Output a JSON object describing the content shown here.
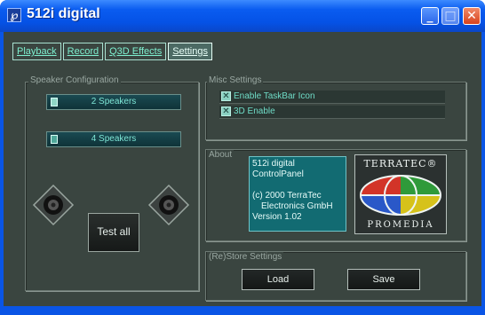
{
  "window": {
    "title": "512i digital",
    "app_icon_glyph": "℘"
  },
  "titlebar": {
    "minimize_glyph": "_",
    "maximize_glyph": "□",
    "close_glyph": "✕"
  },
  "tabs": [
    {
      "label": "Playback"
    },
    {
      "label": "Record"
    },
    {
      "label": "Q3D Effects"
    },
    {
      "label": "Settings"
    }
  ],
  "speaker_config": {
    "title": "Speaker Configuration",
    "two_speakers_label": "2 Speakers",
    "four_speakers_label": "4 Speakers",
    "test_all_label": "Test all"
  },
  "misc": {
    "title": "Misc Settings",
    "taskbar_icon_label": "Enable TaskBar Icon",
    "enable_3d_label": "3D Enable",
    "check_glyph": "✕"
  },
  "about": {
    "title": "About",
    "lines": [
      "512i digital",
      "ControlPanel",
      "",
      "(c) 2000 TerraTec",
      "Electronics GmbH",
      "Version 1.02"
    ],
    "logo_top": "TERRATEC®",
    "logo_bottom": "PROMEDIA"
  },
  "store": {
    "title": "(Re)Store Settings",
    "load_label": "Load",
    "save_label": "Save"
  },
  "colors": {
    "titlebar": "#0a5cf0",
    "panel_bg": "#3a4540",
    "accent_text": "#7ef0d0"
  }
}
